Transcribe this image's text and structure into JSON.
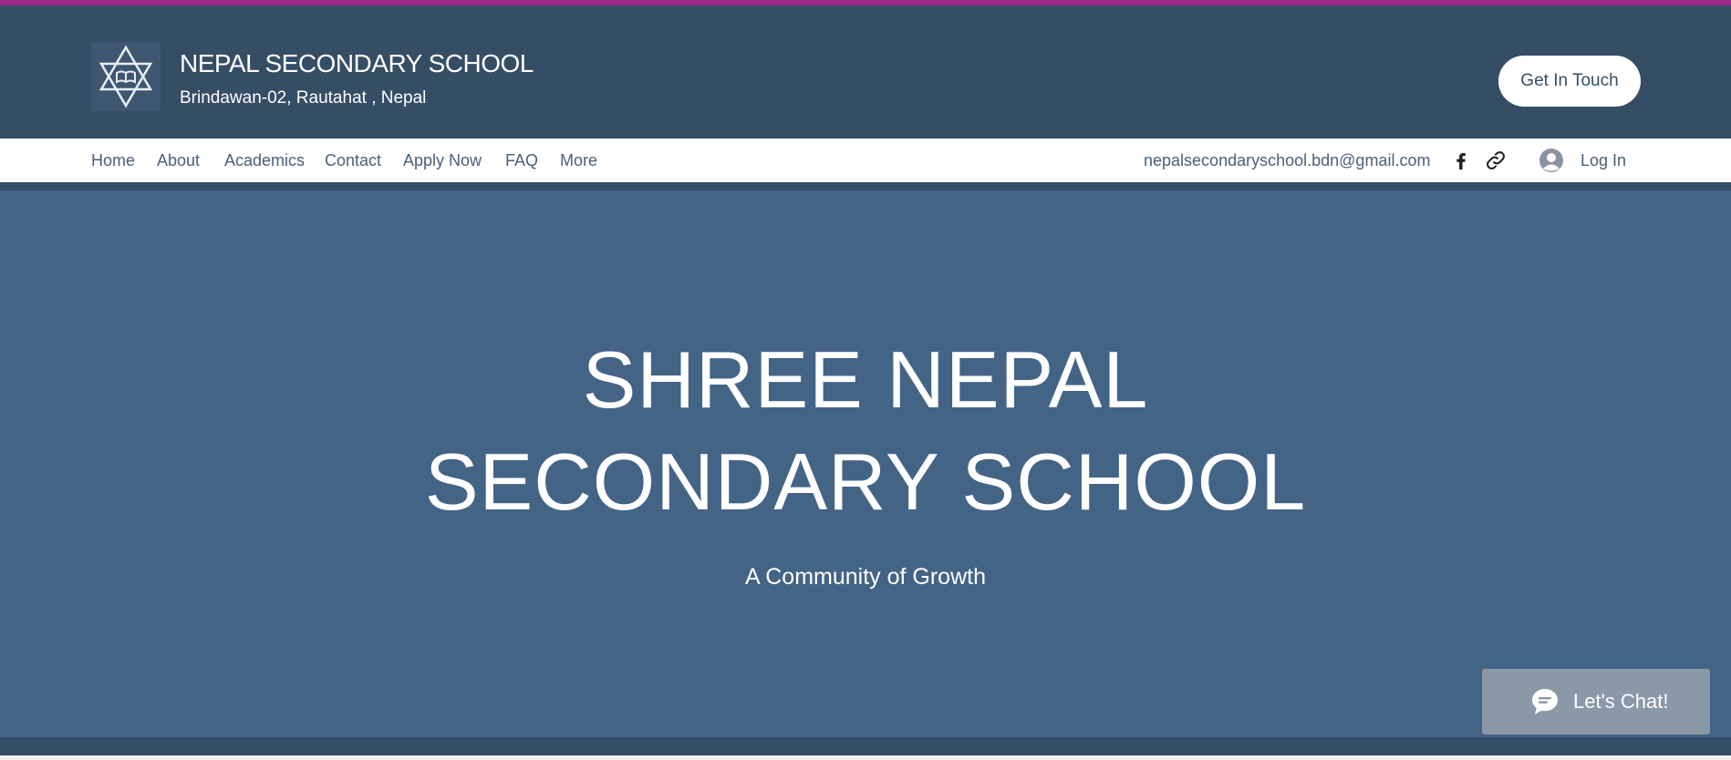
{
  "header": {
    "site_name": "NEPAL SECONDARY SCHOOL",
    "address": "Brindawan-02, Rautahat , Nepal",
    "cta_label": "Get In Touch",
    "logo_icon": "star-of-david-book-icon",
    "accent_color": "#9c2a8c",
    "header_bg": "#364d66"
  },
  "nav": {
    "items": [
      {
        "label": "Home"
      },
      {
        "label": "About"
      },
      {
        "label": "Academics"
      },
      {
        "label": "Contact"
      },
      {
        "label": "Apply Now"
      },
      {
        "label": "FAQ"
      },
      {
        "label": "More"
      }
    ],
    "email": "nepalsecondaryschool.bdn@gmail.com",
    "social_icons": [
      "facebook-icon",
      "link-icon"
    ],
    "login_label": "Log In"
  },
  "hero": {
    "title_line1": "SHREE NEPAL",
    "title_line2": "SECONDARY SCHOOL",
    "subtitle": "A Community of Growth",
    "bg_color": "#446486"
  },
  "chat": {
    "label": "Let's Chat!",
    "icon": "chat-bubble-icon"
  }
}
